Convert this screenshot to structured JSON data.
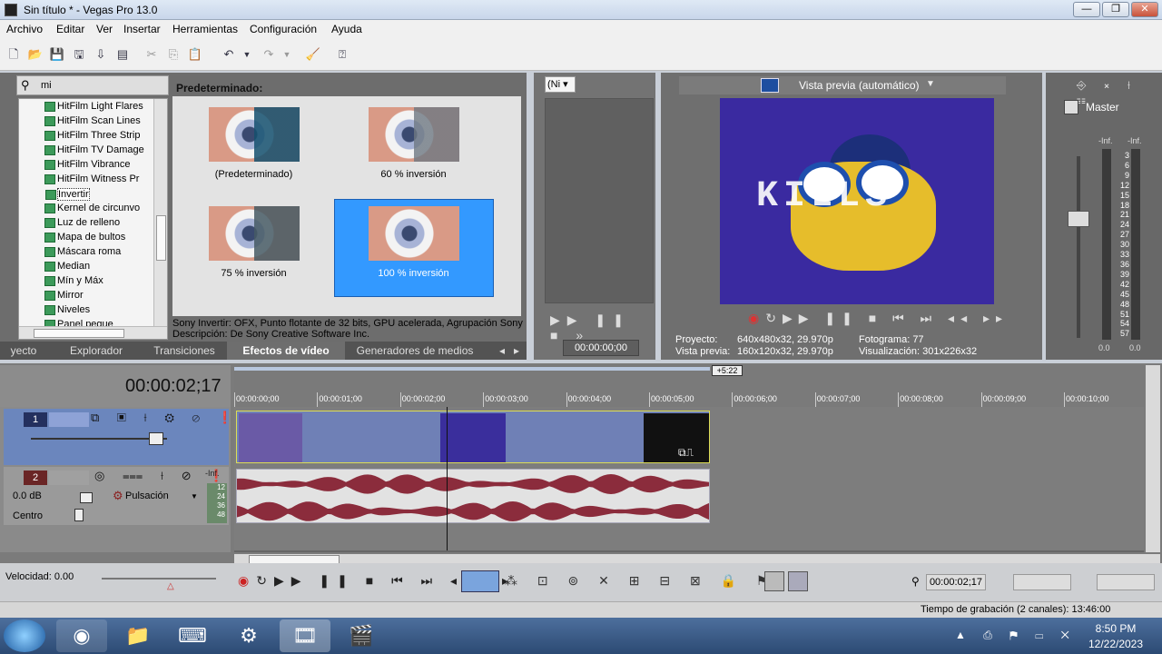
{
  "window": {
    "title": "Sin título * - Vegas Pro 13.0",
    "minimize": "—",
    "maximize": "❐",
    "close": "✕"
  },
  "menu": [
    "Archivo",
    "Editar",
    "Ver",
    "Insertar",
    "Herramientas",
    "Configuración",
    "Ayuda"
  ],
  "fx": {
    "search_value": "mi",
    "tree_items": [
      "HitFilm Light Flares",
      "HitFilm Scan Lines",
      "HitFilm Three Strip",
      "HitFilm TV Damage",
      "HitFilm Vibrance",
      "HitFilm Witness Pr",
      "Invertir",
      "Kernel de circunvo",
      "Luz de relleno",
      "Mapa de bultos",
      "Máscara roma",
      "Median",
      "Mín y Máx",
      "Mirror",
      "Niveles",
      "Panel pegue"
    ],
    "presets_header": "Predeterminado:",
    "presets": [
      "(Predeterminado)",
      "60 % inversión",
      "75 % inversión",
      "100 % inversión"
    ],
    "desc_line1": "Sony Invertir: OFX, Punto flotante de 32 bits, GPU acelerada, Agrupación Sony",
    "desc_line2": "Descripción: De Sony Creative Software Inc.",
    "tabs": [
      "yecto",
      "Explorador",
      "Transiciones",
      "Efectos de vídeo",
      "Generadores de medios"
    ]
  },
  "trimmer": {
    "select": "(Ni",
    "timecode": "00:00:00;00"
  },
  "preview": {
    "mode": "Vista previa (automático)",
    "proyecto_label": "Proyecto:",
    "proyecto": "640x480x32, 29.970p",
    "vista_label": "Vista previa:",
    "vista": "160x120x32, 29.970p",
    "fotograma_label": "Fotograma:",
    "fotograma": "77",
    "visual_label": "Visualización:",
    "visual": "301x226x32"
  },
  "master": {
    "label": "Master",
    "inf_left": "-Inf.",
    "inf_right": "-Inf.",
    "scale": [
      "3",
      "6",
      "9",
      "12",
      "15",
      "18",
      "21",
      "24",
      "27",
      "30",
      "33",
      "36",
      "39",
      "42",
      "45",
      "48",
      "51",
      "54",
      "57"
    ],
    "bottom_left": "0.0",
    "bottom_right": "0.0"
  },
  "timeline": {
    "timecode": "00:00:02;17",
    "end_marker": "+5:22",
    "ruler": [
      "00:00:00;00",
      "00:00:01;00",
      "00:00:02;00",
      "00:00:03;00",
      "00:00:04;00",
      "00:00:05;00",
      "00:00:06;00",
      "00:00:07;00",
      "00:00:08;00",
      "00:00:09;00",
      "00:00:10;00"
    ],
    "video_track_num": "1",
    "audio_track_num": "2",
    "audio_volume": "0.0 dB",
    "audio_pan_mode": "Pulsación",
    "audio_pan_label": "Centro",
    "audio_inf": "-Inf.",
    "audio_meter": [
      "12",
      "24",
      "36",
      "48"
    ],
    "clip_text": "KILLS"
  },
  "transport": {
    "velocity": "Velocidad: 0.00",
    "cursor_time": "00:00:02;17"
  },
  "status": {
    "record_time": "Tiempo de grabación (2 canales): 13:46:00"
  },
  "taskbar": {
    "time": "8:50 PM",
    "date": "12/22/2023"
  }
}
